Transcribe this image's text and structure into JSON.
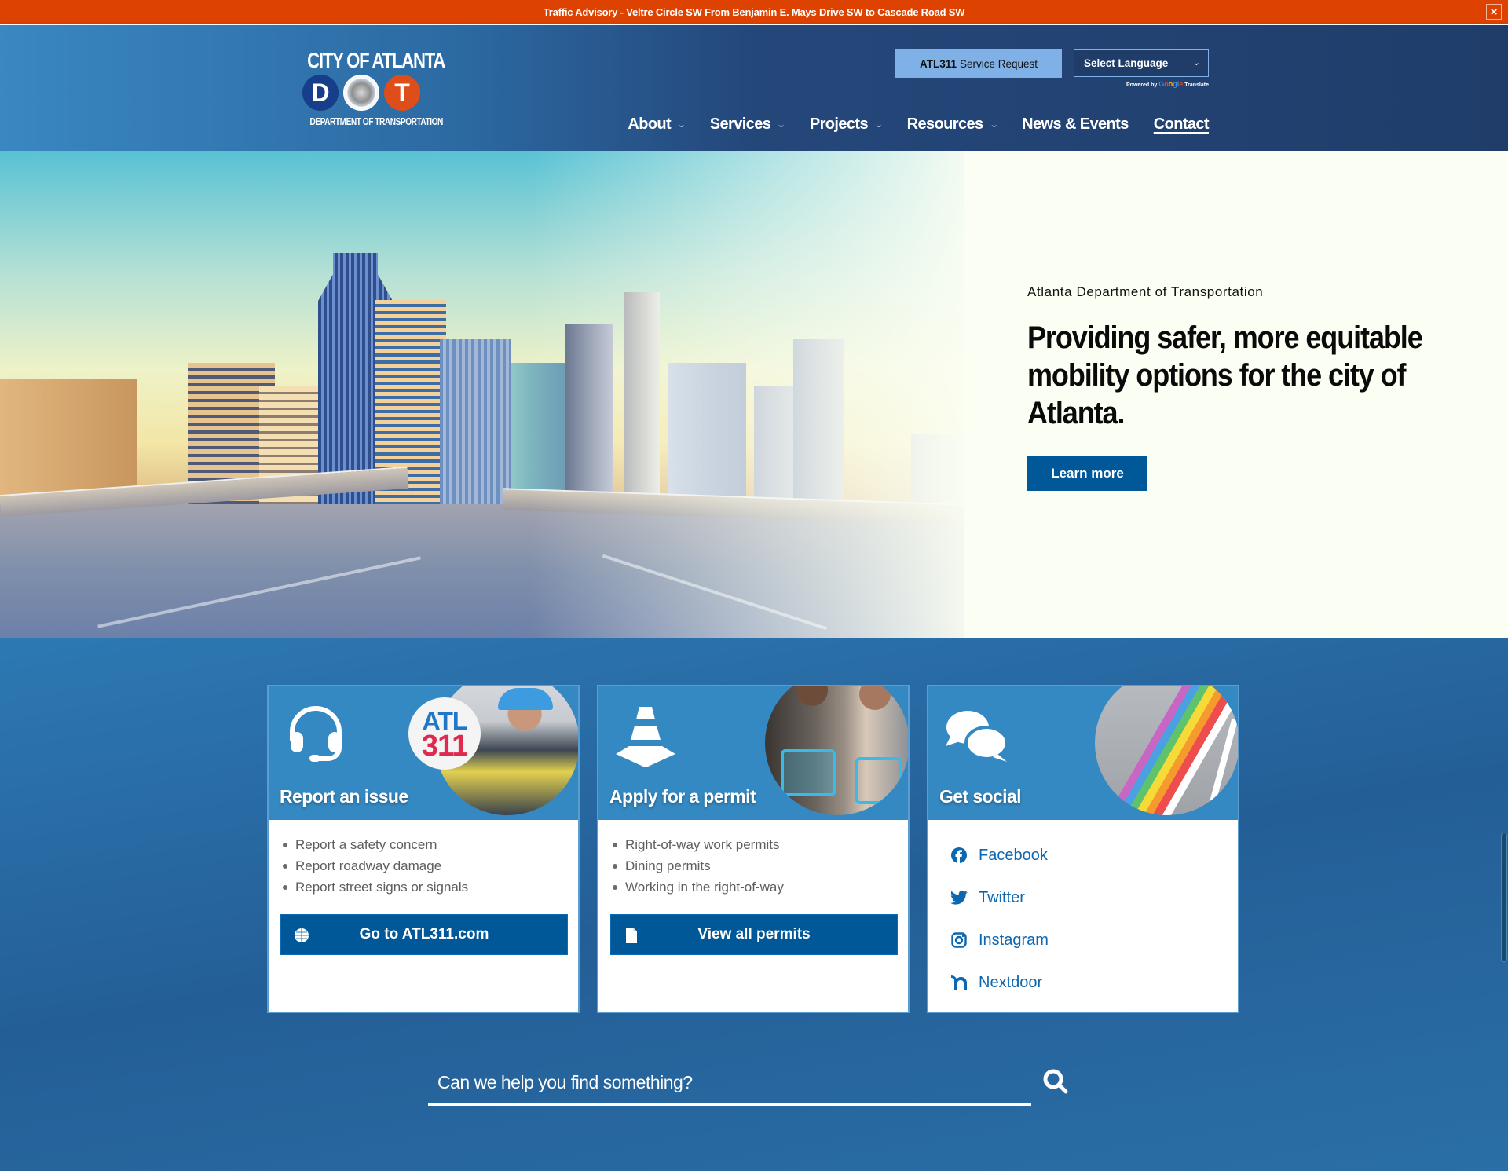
{
  "alert": {
    "text": "Traffic Advisory - Veltre Circle SW From Benjamin E. Mays Drive SW to Cascade Road SW",
    "close_label": "×",
    "color": "#de4200"
  },
  "logo": {
    "title": "CITY OF ATLANTA",
    "letter_left": "D",
    "letter_right": "T",
    "subtitle": "DEPARTMENT OF TRANSPORTATION"
  },
  "header": {
    "service_request": {
      "bold": "ATL311",
      "label": "Service Request"
    },
    "language_select": {
      "selected": "Select Language"
    },
    "powered_by": {
      "prefix": "Powered by",
      "brand": "Google",
      "suffix": "Translate"
    },
    "nav": [
      {
        "label": "About",
        "has_dropdown": true
      },
      {
        "label": "Services",
        "has_dropdown": true
      },
      {
        "label": "Projects",
        "has_dropdown": true
      },
      {
        "label": "Resources",
        "has_dropdown": true
      },
      {
        "label": "News & Events",
        "has_dropdown": false
      },
      {
        "label": "Contact",
        "has_dropdown": false
      }
    ]
  },
  "hero": {
    "eyebrow": "Atlanta Department of Transportation",
    "heading": "Providing safer, more equitable mobility options for the city of Atlanta.",
    "button": "Learn more"
  },
  "cards": [
    {
      "title": "Report an issue",
      "icon": "headset-icon",
      "badge_top": "ATL",
      "badge_bottom": "311",
      "items": [
        "Report a safety concern",
        "Report roadway damage",
        "Report street signs or signals"
      ],
      "button": "Go to ATL311.com",
      "button_icon": "globe-icon"
    },
    {
      "title": "Apply for a permit",
      "icon": "traffic-cone-icon",
      "items": [
        "Right-of-way work permits",
        "Dining permits",
        "Working in the right-of-way"
      ],
      "button": "View all permits",
      "button_icon": "document-icon"
    },
    {
      "title": "Get social",
      "icon": "chat-bubbles-icon",
      "links": [
        {
          "label": "Facebook",
          "icon": "facebook-icon"
        },
        {
          "label": "Twitter",
          "icon": "twitter-icon"
        },
        {
          "label": "Instagram",
          "icon": "instagram-icon"
        },
        {
          "label": "Nextdoor",
          "icon": "nextdoor-icon"
        }
      ]
    }
  ],
  "search": {
    "placeholder": "Can we help you find something?"
  },
  "colors": {
    "primary_button": "#005899",
    "card_header": "#3589c2",
    "link": "#0b67b1",
    "alert": "#de4200",
    "header_dark": "#203d6a"
  }
}
